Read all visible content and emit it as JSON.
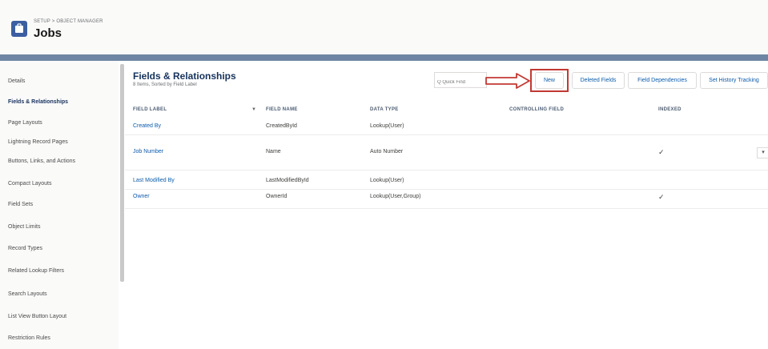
{
  "header": {
    "breadcrumb": "SETUP > OBJECT MANAGER",
    "title": "Jobs"
  },
  "sidebar": {
    "items": [
      {
        "label": "Details"
      },
      {
        "label": "Fields & Relationships"
      },
      {
        "label": "Page Layouts"
      },
      {
        "label": "Lightning Record Pages"
      },
      {
        "label": "Buttons, Links, and Actions"
      },
      {
        "label": "Compact Layouts"
      },
      {
        "label": "Field Sets"
      },
      {
        "label": "Object Limits"
      },
      {
        "label": "Record Types"
      },
      {
        "label": "Related Lookup Filters"
      },
      {
        "label": "Search Layouts"
      },
      {
        "label": "List View Button Layout"
      },
      {
        "label": "Restriction Rules"
      }
    ]
  },
  "section": {
    "title": "Fields & Relationships",
    "subtitle": "8 Items, Sorted by Field Label"
  },
  "toolbar": {
    "quick_find_placeholder": "Q Quick Find",
    "new_label": "New",
    "deleted_fields_label": "Deleted Fields",
    "field_dependencies_label": "Field Dependencies",
    "history_tracking_label": "Set History Tracking"
  },
  "table": {
    "columns": [
      "FIELD LABEL",
      "FIELD NAME",
      "DATA TYPE",
      "CONTROLLING FIELD",
      "INDEXED"
    ],
    "rows": [
      {
        "label": "Created By",
        "name": "CreatedById",
        "type": "Lookup(User)",
        "indexed": ""
      },
      {
        "label": "Job Number",
        "name": "Name",
        "type": "Auto Number",
        "indexed": "✓"
      },
      {
        "label": "Last Modified By",
        "name": "LastModifiedById",
        "type": "Lookup(User)",
        "indexed": ""
      },
      {
        "label": "Owner",
        "name": "OwnerId",
        "type": "Lookup(User,Group)",
        "indexed": "✓"
      }
    ]
  },
  "colors": {
    "highlight_box": "#c23934",
    "band": "#6e86a3",
    "link": "#0b5cab"
  }
}
